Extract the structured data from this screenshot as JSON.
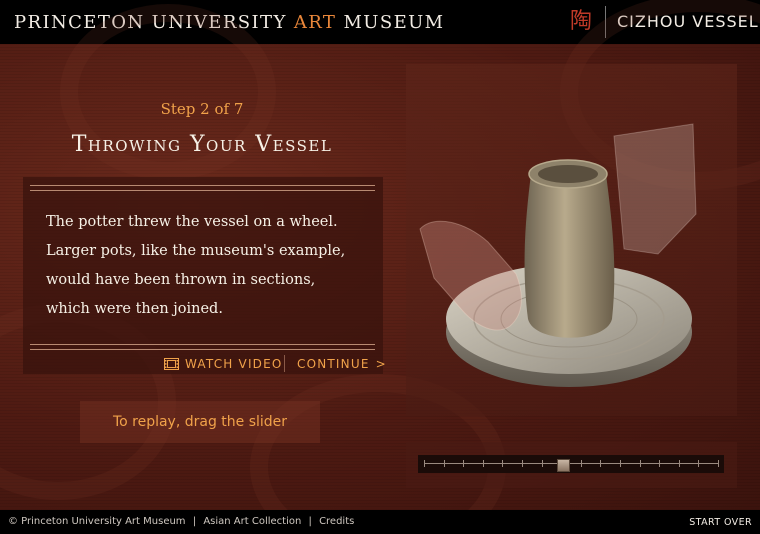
{
  "header": {
    "title_part1": "PRINCETON UNIVERSITY",
    "title_accent": "ART",
    "title_part2": "MUSEUM",
    "seal_char": "陶",
    "vessel_title": "CIZHOU VESSEL"
  },
  "step": {
    "label": "Step 2 of 7",
    "title": "Throwing Your Vessel",
    "text_lines": [
      "The potter threw the vessel on a wheel.",
      "Larger pots, like the museum's example,",
      "would have been thrown in sections,",
      "which were then joined."
    ]
  },
  "controls": {
    "watch_video_label": "WATCH VIDEO",
    "continue_label": "CONTINUE",
    "continue_arrow": ">",
    "replay_hint": "To replay, drag the slider"
  },
  "slider": {
    "position_fraction": 0.47,
    "tick_count": 16
  },
  "footer": {
    "copyright": "© Princeton University Art Museum",
    "links": [
      "Asian Art Collection",
      "Credits"
    ],
    "separator": "|",
    "start_over": "START OVER"
  },
  "icons": {
    "film": "film-icon",
    "seal": "seal-icon",
    "continue_arrow": "chevron-right-icon"
  },
  "colors": {
    "accent_orange": "#f0a24a",
    "background_maroon": "#4e1a12",
    "text_cream": "#f7f1e6",
    "header_black": "#000000",
    "seal_red": "#c03a28"
  }
}
